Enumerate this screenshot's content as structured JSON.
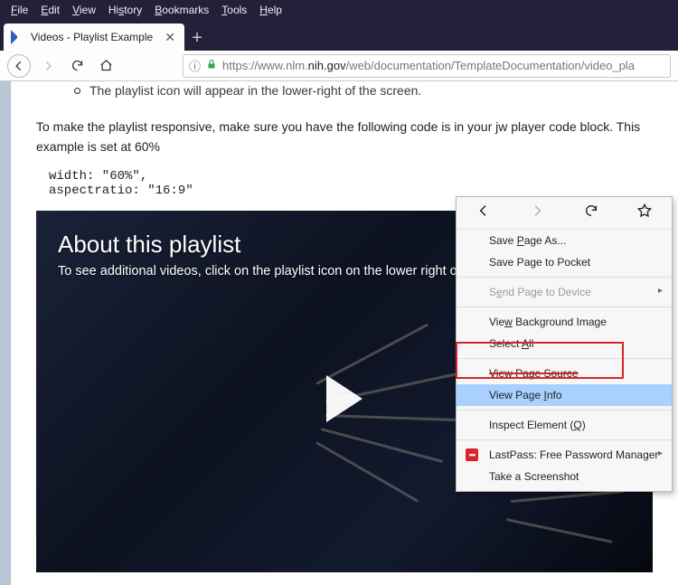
{
  "menubar": [
    "File",
    "Edit",
    "View",
    "History",
    "Bookmarks",
    "Tools",
    "Help"
  ],
  "menubar_ul": [
    "F",
    "E",
    "V",
    "Hi",
    "B",
    "T",
    "He"
  ],
  "tab": {
    "title": "Videos - Playlist Example"
  },
  "url": {
    "prefix": "https://www.nlm.",
    "domain": "nih.gov",
    "suffix": "/web/documentation/TemplateDocumentation/video_pla"
  },
  "content": {
    "bullet_cut": "The playlist icon will appear in the lower-right of the screen.",
    "para": "To make the playlist responsive, make sure you have the following code is in your jw player code block. This example is set at 60%",
    "code": "width: \"60%\",\naspectratio: \"16:9\""
  },
  "video": {
    "title": "About this playlist",
    "sub": "To see additional videos, click on the playlist icon on the lower right of"
  },
  "ctx": {
    "save_as": "Save Page As...",
    "save_pocket": "Save Page to Pocket",
    "send_device": "Send Page to Device",
    "view_bg": "View Background Image",
    "select_all": "Select All",
    "view_source": "View Page Source",
    "view_info": "View Page Info",
    "inspect": "Inspect Element (Q)",
    "lastpass": "LastPass: Free Password Manager",
    "screenshot": "Take a Screenshot"
  }
}
